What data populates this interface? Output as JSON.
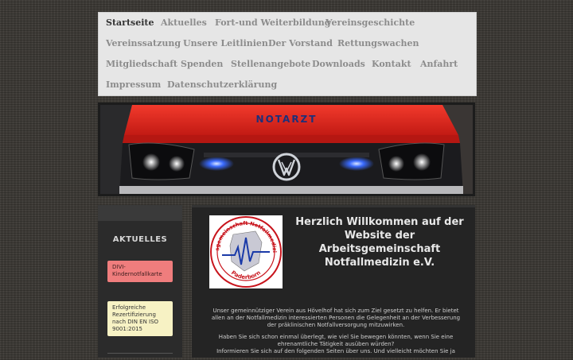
{
  "nav": {
    "items": [
      "Startseite",
      "Aktuelles",
      "Fort-und Weiterbildung",
      "Vereinsgeschichte",
      "Vereinssatzung",
      "Unsere Leitlinien",
      "Der Vorstand",
      "Rettungswachen",
      "Mitgliedschaft",
      "Spenden",
      "Stellenangebote",
      "Downloads",
      "Kontakt",
      "Anfahrt",
      "Impressum",
      "Datenschutzerklärung"
    ],
    "active": "Startseite"
  },
  "hero": {
    "plate_text": "NOTARZT"
  },
  "sidebar": {
    "heading": "AKTUELLES",
    "note1": "DIVI-Kindernotfallkarte",
    "note2": "Erfolgreiche Rezertifizierung nach DIN EN ISO 9001:2015"
  },
  "logo": {
    "ring_text": "Arbeitsgemeinschaft Notfallmedizin e.V.",
    "city": "Paderborn"
  },
  "main": {
    "title": "Herzlich Willkommen auf der Website der Arbeitsgemeinschaft Notfallmedizin e.V.",
    "para1": "Unser gemeinnütziger Verein aus Hövelhof hat sich zum Ziel gesetzt zu helfen. Er bietet allen an der Notfallmedizin interessierten Personen die Gelegenheit an der Verbesserung der präklinischen Notfallversorgung mitzuwirken.",
    "para2": "Haben Sie sich schon einmal überlegt, wie viel Sie bewegen könnten, wenn Sie eine ehrenamtliche Tätigkeit ausüben würden?",
    "para3": "Informieren Sie sich auf den folgenden Seiten über uns. Und vielleicht möchten Sie ja"
  },
  "colors": {
    "accent_red": "#e8231c",
    "note_red": "#ef7d7d",
    "note_yellow": "#f7f2c4",
    "siren_blue": "#3a6bff"
  }
}
